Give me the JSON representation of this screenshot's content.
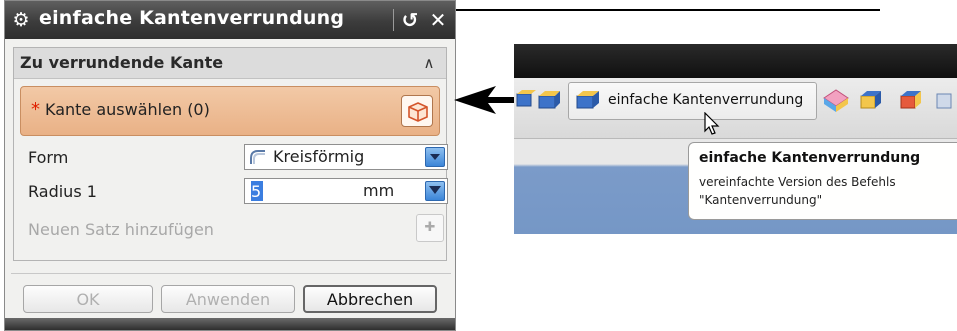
{
  "dialog": {
    "title": "einfache Kantenverrundung",
    "section_title": "Zu verrundende Kante",
    "select_edge_label": "Kante auswählen (0)",
    "required_marker": "*",
    "form_label": "Form",
    "form_value": "Kreisförmig",
    "radius_label": "Radius 1",
    "radius_value": "5",
    "radius_unit": "mm",
    "new_set_label": "Neuen Satz hinzufügen",
    "ok_label": "OK",
    "apply_label": "Anwenden",
    "cancel_label": "Abbrechen"
  },
  "toolbar": {
    "button_label": "einfache Kantenverrundung",
    "tooltip_title": "einfache Kantenverrundung",
    "tooltip_line1": "vereinfachte Version des Befehls",
    "tooltip_line2": "\"Kantenverrundung\""
  },
  "colors": {
    "titlebar": "#3c3c3c",
    "selection_row": "#e9b186",
    "required_star": "#e02000",
    "toolbar_background": "#7597c6"
  },
  "icons": [
    "gear-icon",
    "reset-icon",
    "close-icon",
    "collapse-icon",
    "select-edge-icon",
    "fillet-shape-icon",
    "dropdown-arrow-icon",
    "add-set-icon",
    "arrow-icon",
    "cursor-icon"
  ]
}
